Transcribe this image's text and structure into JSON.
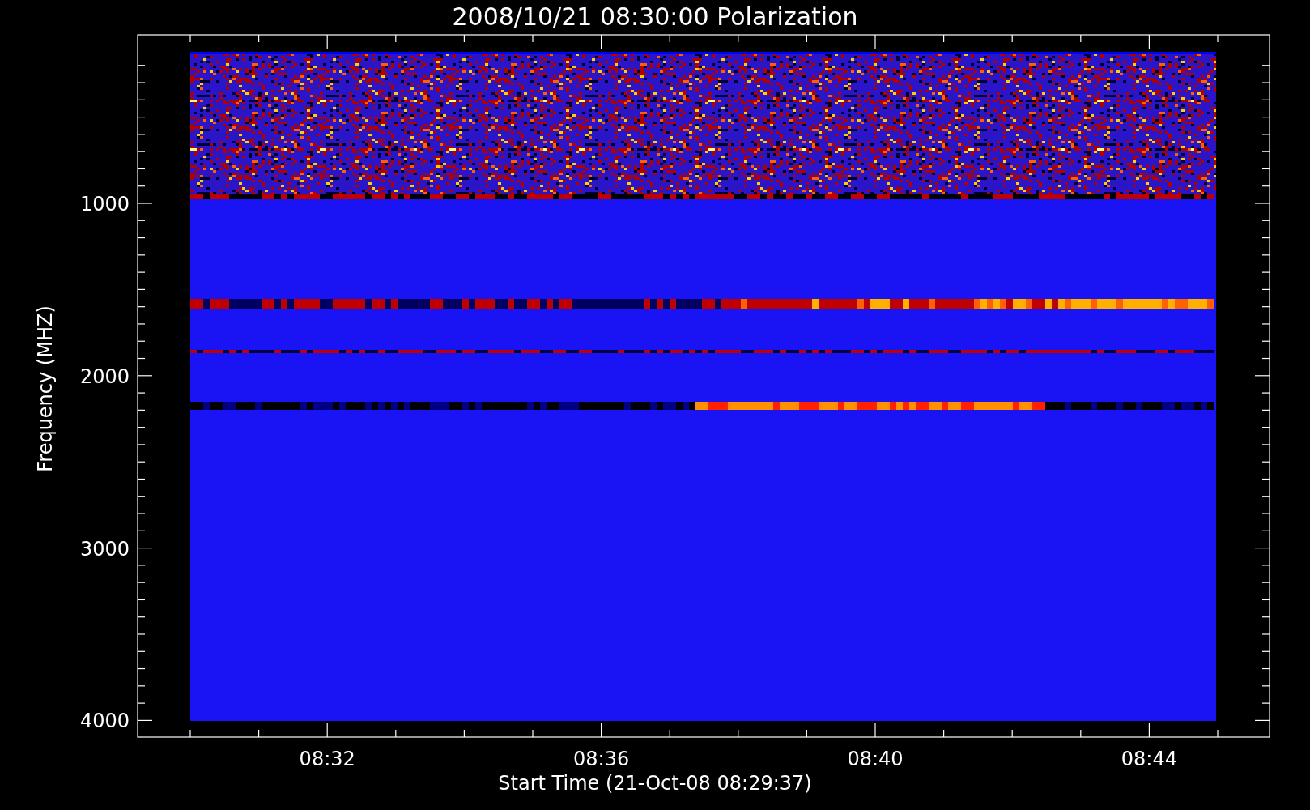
{
  "title": "2008/10/21 08:30:00 Polarization",
  "y_axis": {
    "label": "Frequency (MHZ)",
    "ticks": [
      "1000",
      "2000",
      "3000",
      "4000"
    ]
  },
  "x_axis": {
    "label": "Start Time (21-Oct-08 08:29:37)",
    "ticks": [
      "08:32",
      "08:36",
      "08:40",
      "08:44"
    ]
  }
}
